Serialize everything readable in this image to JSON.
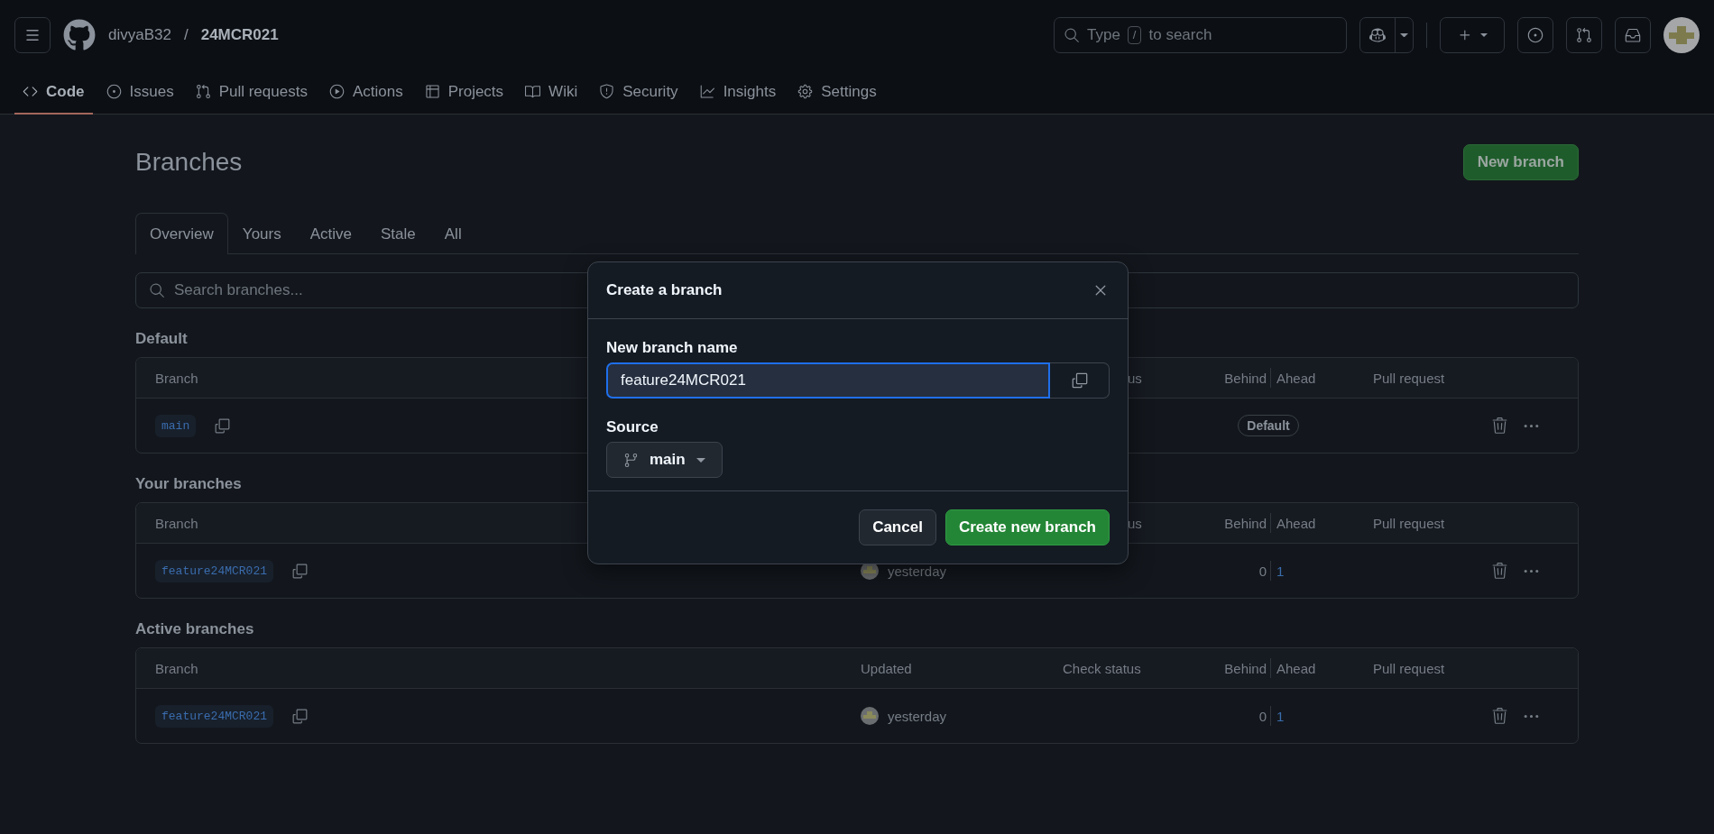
{
  "header": {
    "owner": "divyaB32",
    "separator": "/",
    "repo": "24MCR021",
    "search": {
      "text_before": "Type",
      "shortcut_key": "/",
      "text_after": "to search"
    }
  },
  "nav_tabs": [
    {
      "label": "Code",
      "selected": true
    },
    {
      "label": "Issues",
      "selected": false
    },
    {
      "label": "Pull requests",
      "selected": false
    },
    {
      "label": "Actions",
      "selected": false
    },
    {
      "label": "Projects",
      "selected": false
    },
    {
      "label": "Wiki",
      "selected": false
    },
    {
      "label": "Security",
      "selected": false
    },
    {
      "label": "Insights",
      "selected": false
    },
    {
      "label": "Settings",
      "selected": false
    }
  ],
  "page": {
    "title": "Branches",
    "new_branch_button": "New branch"
  },
  "filter_tabs": [
    {
      "label": "Overview",
      "selected": true
    },
    {
      "label": "Yours",
      "selected": false
    },
    {
      "label": "Active",
      "selected": false
    },
    {
      "label": "Stale",
      "selected": false
    },
    {
      "label": "All",
      "selected": false
    }
  ],
  "branch_search": {
    "placeholder": "Search branches..."
  },
  "sections": [
    {
      "title": "Default",
      "columns": [
        {
          "kind": "branch",
          "label": "Branch"
        },
        {
          "kind": "check_partial",
          "label": "us"
        },
        {
          "kind": "behind",
          "label": "Behind"
        },
        {
          "kind": "ahead",
          "label": "Ahead"
        },
        {
          "kind": "pr",
          "label": "Pull request"
        }
      ],
      "rows": [
        {
          "name": "main",
          "badge": "Default"
        }
      ]
    },
    {
      "title": "Your branches",
      "columns": [
        {
          "kind": "branch",
          "label": "Branch"
        },
        {
          "kind": "check_partial",
          "label": "us"
        },
        {
          "kind": "behind",
          "label": "Behind"
        },
        {
          "kind": "ahead",
          "label": "Ahead"
        },
        {
          "kind": "pr",
          "label": "Pull request"
        }
      ],
      "rows": [
        {
          "name": "feature24MCR021",
          "updated": "yesterday",
          "behind": "0",
          "ahead": "1"
        }
      ]
    },
    {
      "title": "Active branches",
      "columns": [
        {
          "kind": "branch",
          "label": "Branch"
        },
        {
          "kind": "updated",
          "label": "Updated"
        },
        {
          "kind": "check",
          "label": "Check status"
        },
        {
          "kind": "behind",
          "label": "Behind"
        },
        {
          "kind": "ahead",
          "label": "Ahead"
        },
        {
          "kind": "pr",
          "label": "Pull request"
        }
      ],
      "rows": [
        {
          "name": "feature24MCR021",
          "updated": "yesterday",
          "behind": "0",
          "ahead": "1"
        }
      ]
    }
  ],
  "dialog": {
    "title": "Create a branch",
    "name_label": "New branch name",
    "name_value": "feature24MCR021",
    "source_label": "Source",
    "source_branch": "main",
    "buttons": [
      {
        "label": "Cancel",
        "kind": "secondary"
      },
      {
        "label": "Create new branch",
        "kind": "primary"
      }
    ]
  }
}
